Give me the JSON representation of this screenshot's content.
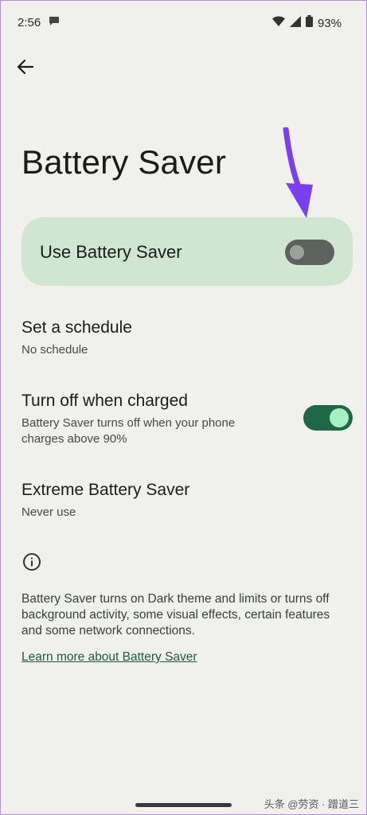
{
  "status": {
    "time": "2:56",
    "battery_pct": "93%",
    "icons": [
      "message-icon",
      "wifi-icon",
      "cell-signal-icon",
      "battery-icon"
    ]
  },
  "nav": {
    "back_icon": "arrow-left-icon"
  },
  "page": {
    "title": "Battery Saver"
  },
  "main_toggle": {
    "label": "Use Battery Saver",
    "state": "off"
  },
  "rows": [
    {
      "title": "Set a schedule",
      "subtitle": "No schedule"
    },
    {
      "title": "Turn off when charged",
      "subtitle_line1": "Battery Saver turns off when your phone",
      "subtitle_line2": "charges above 90%",
      "toggle_state": "on"
    },
    {
      "title": "Extreme Battery Saver",
      "subtitle": "Never use"
    }
  ],
  "info": {
    "icon": "info-icon",
    "text": "Battery Saver turns on Dark theme and limits or turns off background activity, some visual effects, certain features and some network connections.",
    "link": "Learn more about Battery Saver"
  },
  "watermark": "头条 @劳资 · 蹭道三",
  "colors": {
    "background": "#f0f1ec",
    "card": "#cfe6d0",
    "toggle_on": "#1e6846",
    "toggle_on_thumb": "#a6efc1",
    "toggle_off": "#5e625e",
    "link": "#1d5b3e",
    "annotation_arrow": "#7b3ff2"
  }
}
